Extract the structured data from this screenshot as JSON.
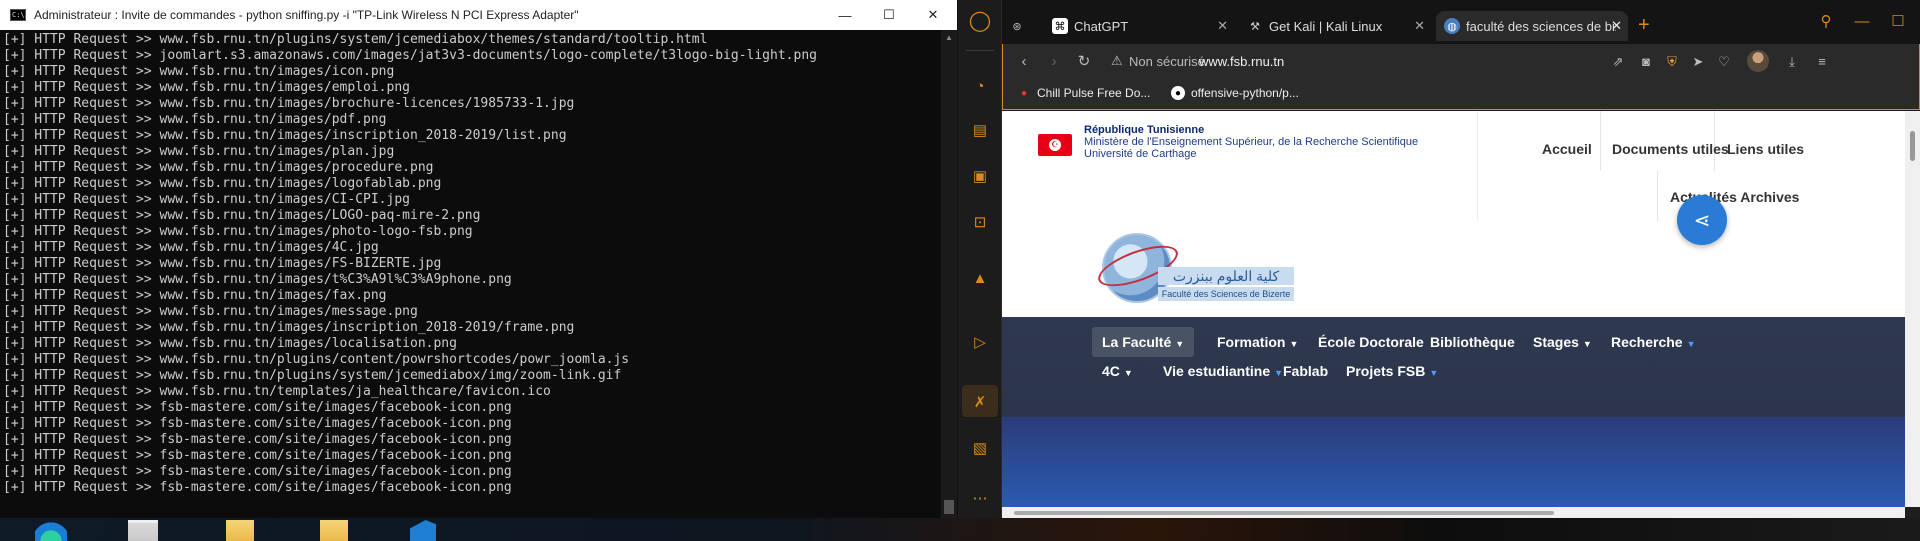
{
  "cmd": {
    "title": "Administrateur : Invite de commandes - python  sniffing.py -i \"TP-Link Wireless N PCI Express Adapter\"",
    "icon_text": "C:\\",
    "controls": {
      "minimize": "—",
      "maximize": "☐",
      "close": "✕"
    },
    "lines": [
      "[+] HTTP Request >> www.fsb.rnu.tn/plugins/system/jcemediabox/themes/standard/tooltip.html",
      "[+] HTTP Request >> joomlart.s3.amazonaws.com/images/jat3v3-documents/logo-complete/t3logo-big-light.png",
      "[+] HTTP Request >> www.fsb.rnu.tn/images/icon.png",
      "[+] HTTP Request >> www.fsb.rnu.tn/images/emploi.png",
      "[+] HTTP Request >> www.fsb.rnu.tn/images/brochure-licences/1985733-1.jpg",
      "[+] HTTP Request >> www.fsb.rnu.tn/images/pdf.png",
      "[+] HTTP Request >> www.fsb.rnu.tn/images/inscription_2018-2019/list.png",
      "[+] HTTP Request >> www.fsb.rnu.tn/images/plan.jpg",
      "[+] HTTP Request >> www.fsb.rnu.tn/images/procedure.png",
      "[+] HTTP Request >> www.fsb.rnu.tn/images/logofablab.png",
      "[+] HTTP Request >> www.fsb.rnu.tn/images/CI-CPI.jpg",
      "[+] HTTP Request >> www.fsb.rnu.tn/images/LOGO-paq-mire-2.png",
      "[+] HTTP Request >> www.fsb.rnu.tn/images/photo-logo-fsb.png",
      "[+] HTTP Request >> www.fsb.rnu.tn/images/4C.jpg",
      "[+] HTTP Request >> www.fsb.rnu.tn/images/FS-BIZERTE.jpg",
      "[+] HTTP Request >> www.fsb.rnu.tn/images/t%C3%A9l%C3%A9phone.png",
      "[+] HTTP Request >> www.fsb.rnu.tn/images/fax.png",
      "[+] HTTP Request >> www.fsb.rnu.tn/images/message.png",
      "[+] HTTP Request >> www.fsb.rnu.tn/images/inscription_2018-2019/frame.png",
      "[+] HTTP Request >> www.fsb.rnu.tn/images/localisation.png",
      "[+] HTTP Request >> www.fsb.rnu.tn/plugins/content/powrshortcodes/powr_joomla.js",
      "[+] HTTP Request >> www.fsb.rnu.tn/plugins/system/jcemediabox/img/zoom-link.gif",
      "[+] HTTP Request >> www.fsb.rnu.tn/templates/ja_healthcare/favicon.ico",
      "[+] HTTP Request >> fsb-mastere.com/site/images/facebook-icon.png",
      "[+] HTTP Request >> fsb-mastere.com/site/images/facebook-icon.png",
      "[+] HTTP Request >> fsb-mastere.com/site/images/facebook-icon.png",
      "[+] HTTP Request >> fsb-mastere.com/site/images/facebook-icon.png",
      "[+] HTTP Request >> fsb-mastere.com/site/images/facebook-icon.png",
      "[+] HTTP Request >> fsb-mastere.com/site/images/facebook-icon.png"
    ]
  },
  "browser": {
    "accent": "#d88a1c",
    "tabs": [
      {
        "label": "ChatGPT",
        "icon": "chatgpt-icon"
      },
      {
        "label": "Get Kali | Kali Linux",
        "icon": "kali-icon"
      },
      {
        "label": "faculté des sciences de bizerte",
        "icon": "globe-icon"
      }
    ],
    "address": {
      "security_label": "Non sécurisé",
      "url": "www.fsb.rnu.tn"
    },
    "bookmarks": [
      {
        "label": "Chill Pulse Free Do...",
        "icon": "chill-pulse-icon"
      },
      {
        "label": "offensive-python/p...",
        "icon": "github-icon"
      }
    ]
  },
  "page": {
    "gov": {
      "republic": "République Tunisienne",
      "ministry": "Ministère de l'Enseignement Supérieur, de la Recherche Scientifique",
      "university": "Université de Carthage"
    },
    "topnav": {
      "accueil": "Accueil",
      "documents": "Documents utiles",
      "liens": "Liens utiles",
      "actualites": "Actualités Archives"
    },
    "logo": {
      "arabic": "كلية العلوم ببنزرت",
      "french": "Faculté des Sciences de Bizerte"
    },
    "mainnav": {
      "faculte": "La Faculté",
      "formation": "Formation",
      "ecole": "École Doctorale",
      "biblio": "Bibliothèque",
      "stages": "Stages",
      "recherche": "Recherche",
      "c4": "4C",
      "vie": "Vie estudiantine",
      "fablab": "Fablab",
      "projets": "Projets FSB"
    }
  }
}
